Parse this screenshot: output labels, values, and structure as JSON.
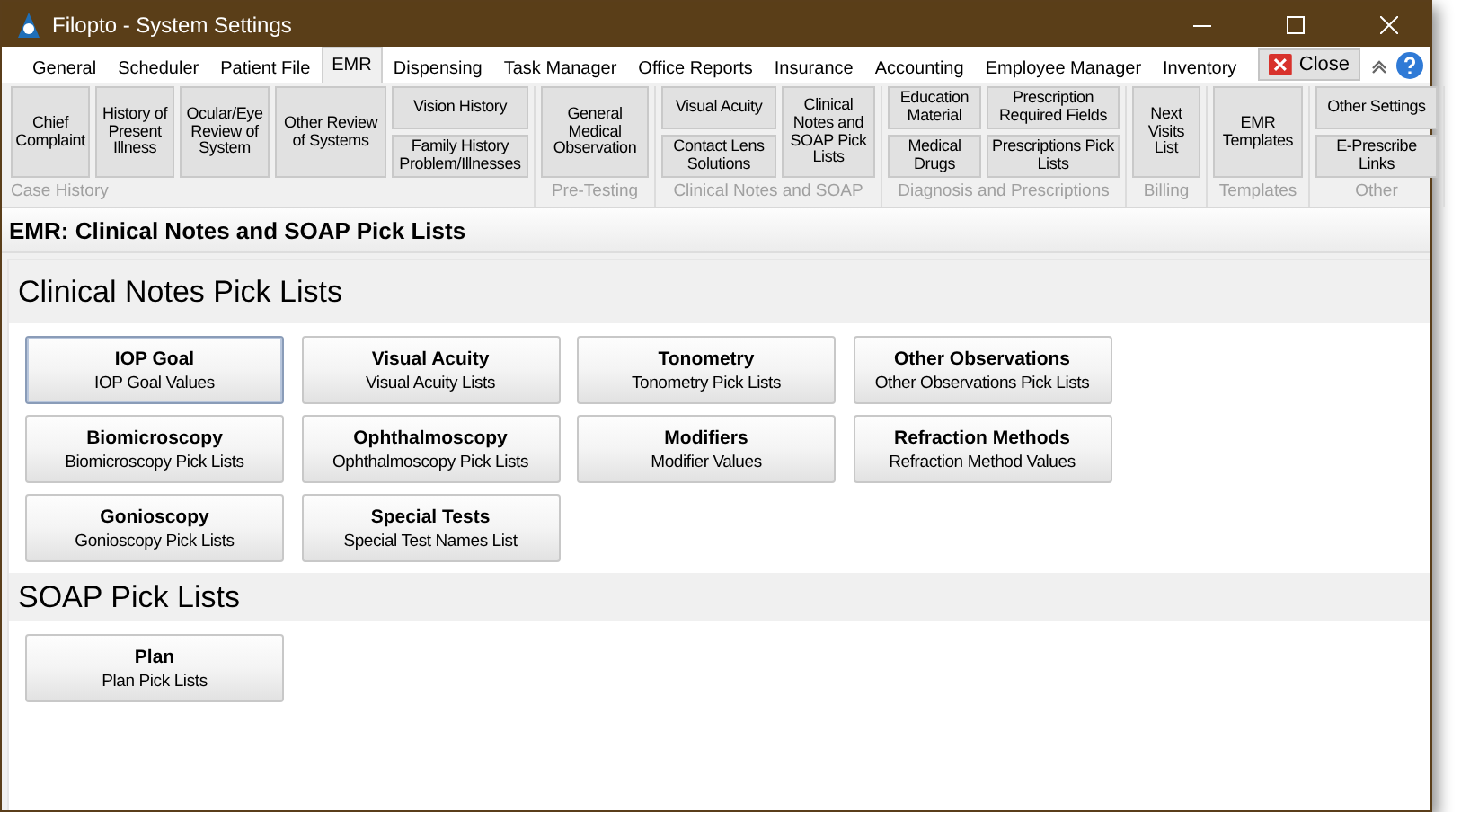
{
  "window": {
    "title": "Filopto - System Settings"
  },
  "tabs": [
    {
      "label": "General",
      "selected": false
    },
    {
      "label": "Scheduler",
      "selected": false
    },
    {
      "label": "Patient File",
      "selected": false
    },
    {
      "label": "EMR",
      "selected": true
    },
    {
      "label": "Dispensing",
      "selected": false
    },
    {
      "label": "Task Manager",
      "selected": false
    },
    {
      "label": "Office Reports",
      "selected": false
    },
    {
      "label": "Insurance",
      "selected": false
    },
    {
      "label": "Accounting",
      "selected": false
    },
    {
      "label": "Employee Manager",
      "selected": false
    },
    {
      "label": "Inventory",
      "selected": false
    }
  ],
  "close_button": {
    "label": "Close"
  },
  "ribbon_groups": [
    {
      "label": "Case History",
      "columns": [
        [
          "Chief Complaint"
        ],
        [
          "History of Present Illness"
        ],
        [
          "Ocular/Eye Review of System"
        ],
        [
          "Other Review of Systems"
        ],
        [
          "Vision History",
          "Family History Problem/Illnesses"
        ]
      ]
    },
    {
      "label": "Pre-Testing",
      "columns": [
        [
          "General Medical Observation"
        ]
      ]
    },
    {
      "label": "Clinical Notes and SOAP",
      "columns": [
        [
          "Visual Acuity",
          "Contact Lens Solutions"
        ],
        [
          "Clinical Notes and SOAP Pick Lists"
        ]
      ]
    },
    {
      "label": "Diagnosis and Prescriptions",
      "columns": [
        [
          "Education Material",
          "Medical Drugs"
        ],
        [
          "Prescription Required Fields",
          "Prescriptions Pick Lists"
        ]
      ]
    },
    {
      "label": "Billing",
      "columns": [
        [
          "Next Visits List"
        ]
      ]
    },
    {
      "label": "Templates",
      "columns": [
        [
          "EMR Templates"
        ]
      ]
    },
    {
      "label": "Other",
      "columns": [
        [
          "Other Settings",
          "E-Prescribe Links"
        ]
      ]
    }
  ],
  "page_title": "EMR: Clinical Notes and SOAP Pick Lists",
  "sections": [
    {
      "title": "Clinical Notes Pick Lists",
      "items": [
        {
          "title": "IOP Goal",
          "subtitle": "IOP Goal Values",
          "selected": true
        },
        {
          "title": "Visual Acuity",
          "subtitle": "Visual Acuity Lists",
          "selected": false
        },
        {
          "title": "Tonometry",
          "subtitle": "Tonometry Pick Lists",
          "selected": false
        },
        {
          "title": "Other Observations",
          "subtitle": "Other Observations Pick Lists",
          "selected": false
        },
        {
          "title": "Biomicroscopy",
          "subtitle": "Biomicroscopy Pick Lists",
          "selected": false
        },
        {
          "title": "Ophthalmoscopy",
          "subtitle": "Ophthalmoscopy Pick Lists",
          "selected": false
        },
        {
          "title": "Modifiers",
          "subtitle": "Modifier Values",
          "selected": false
        },
        {
          "title": "Refraction Methods",
          "subtitle": "Refraction Method Values",
          "selected": false
        },
        {
          "title": "Gonioscopy",
          "subtitle": "Gonioscopy Pick Lists",
          "selected": false
        },
        {
          "title": "Special Tests",
          "subtitle": "Special Test Names List",
          "selected": false
        }
      ]
    },
    {
      "title": "SOAP Pick Lists",
      "items": [
        {
          "title": "Plan",
          "subtitle": "Plan Pick Lists",
          "selected": false
        }
      ]
    }
  ]
}
